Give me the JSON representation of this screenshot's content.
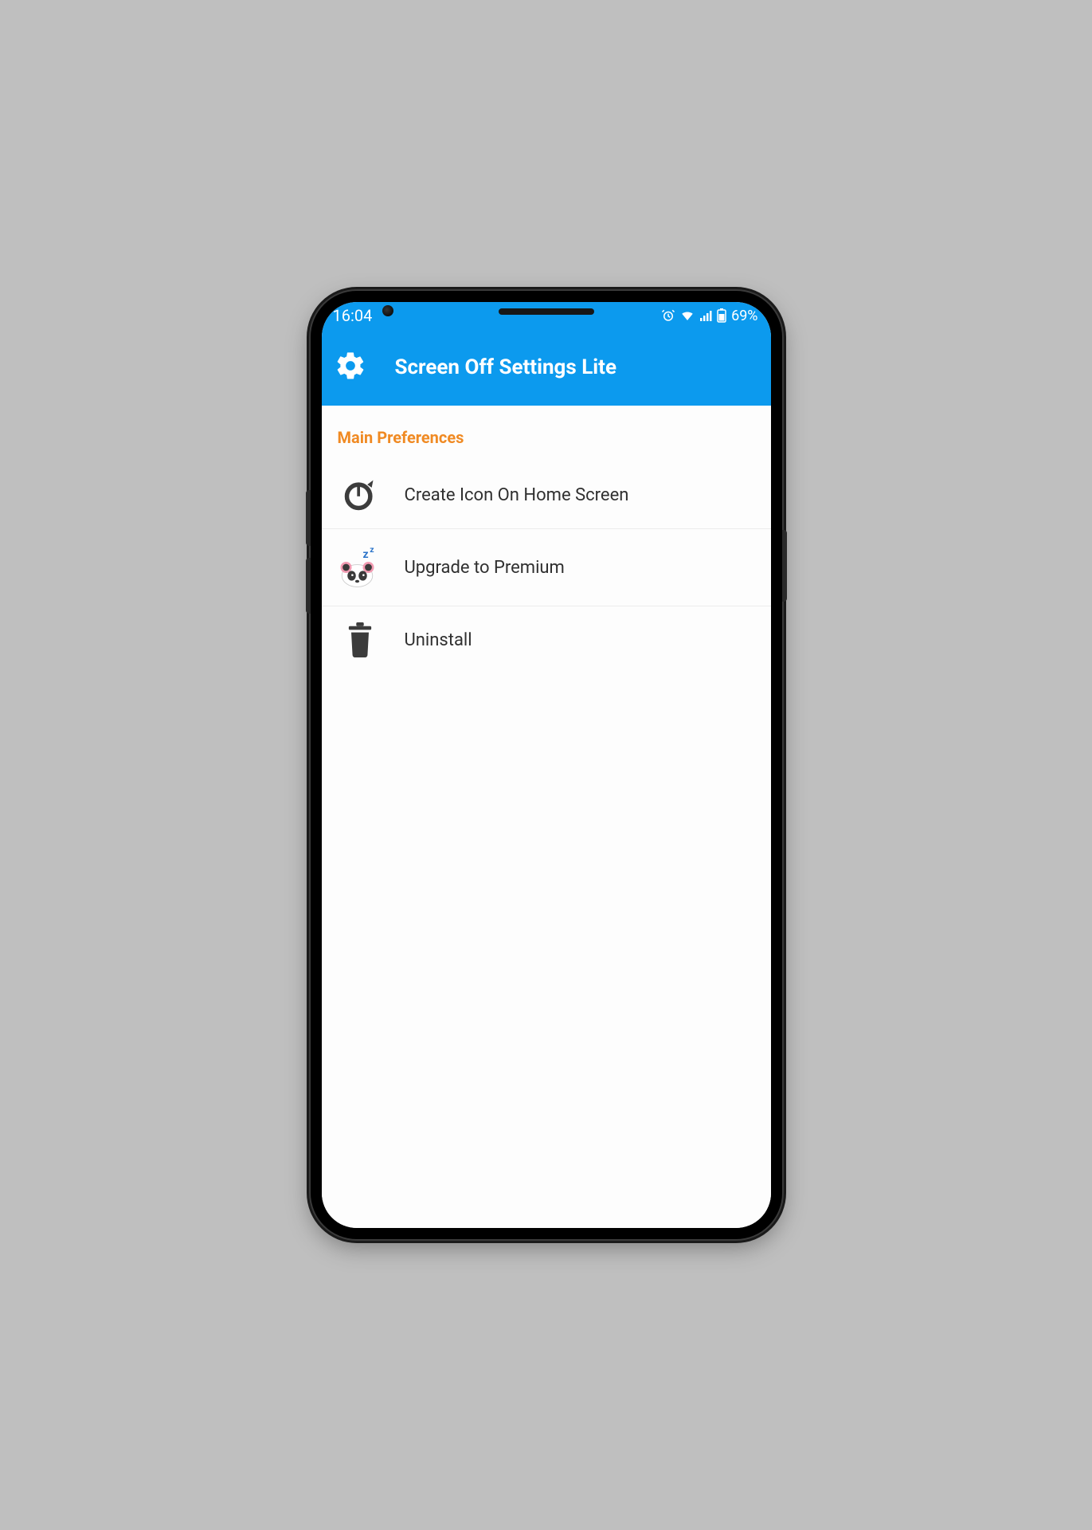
{
  "status": {
    "time": "16:04",
    "battery_text": "69%"
  },
  "appbar": {
    "title": "Screen Off Settings Lite"
  },
  "section": {
    "title": "Main Preferences"
  },
  "items": {
    "create_icon": "Create Icon On Home Screen",
    "upgrade": "Upgrade to Premium",
    "uninstall": "Uninstall"
  }
}
